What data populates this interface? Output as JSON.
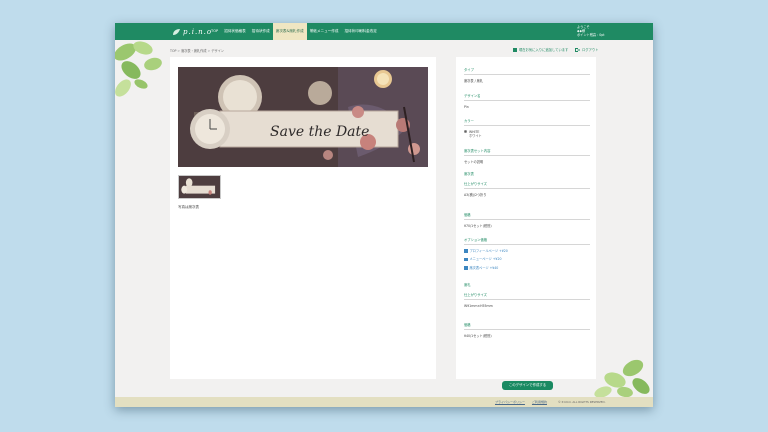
{
  "colors": {
    "accent": "#1f8a63",
    "nav_active_bg": "#efe6c2",
    "link": "#3c86c0",
    "footer_bg": "#e3dfc1",
    "backdrop": "#bfdcec"
  },
  "logo": {
    "text": "p.i.n.o"
  },
  "nav": {
    "items": [
      {
        "label": "TOP",
        "active": false
      },
      {
        "label": "招待状価格表",
        "active": false
      },
      {
        "label": "招待状作成",
        "active": false
      },
      {
        "label": "席次表&席札作成",
        "active": true
      },
      {
        "label": "帯紙メニュー作成",
        "active": false
      },
      {
        "label": "招待状印刷料金改定",
        "active": false
      }
    ]
  },
  "user": {
    "greeting": "ようこそ",
    "name": "◆◆様",
    "points": "ポイント残高 : 0pt"
  },
  "breadcrumb": {
    "items": [
      "TOP",
      "席次表・席札作成",
      "デザイン"
    ]
  },
  "favorites": {
    "label": "現在お気に入りに追加しています"
  },
  "logout": {
    "label": "ログアウト"
  },
  "main": {
    "image_text": "Save the Date",
    "caption": "写真は席次表"
  },
  "spec": {
    "type_label": "タイプ",
    "type_value": "席次表 / 席札",
    "design_label": "デザイン名",
    "design_value": "Pin",
    "color_label": "カラー",
    "color_opt1": "WHITE",
    "color_opt2": "ホワイト",
    "set_label": "席次表セット内容",
    "set_value": "セットの説明",
    "seating_label": "席次表",
    "seating_size_label": "仕上がりサイズ",
    "seating_size_value": "A3(横)/2つ折り",
    "price_label": "価格",
    "price_value": "¥70/1セット(税別)",
    "option_label": "オプション価格",
    "options": [
      "プロフィールページ +¥20",
      "メニューページ +¥20",
      "席次表ページ +¥40"
    ],
    "card_label": "席札",
    "card_size_label": "仕上がりサイズ",
    "card_size_value": "W91mm×H55mm",
    "card_price_label": "価格",
    "card_price_value": "¥40/1セット(税別)"
  },
  "create_button": {
    "label": "このデザインで作成する"
  },
  "footer": {
    "privacy": "プライバシーポリシー",
    "law": "ご利用規約",
    "copyright": "© P.I.N.O. ALL RIGHTS RESERVED."
  }
}
